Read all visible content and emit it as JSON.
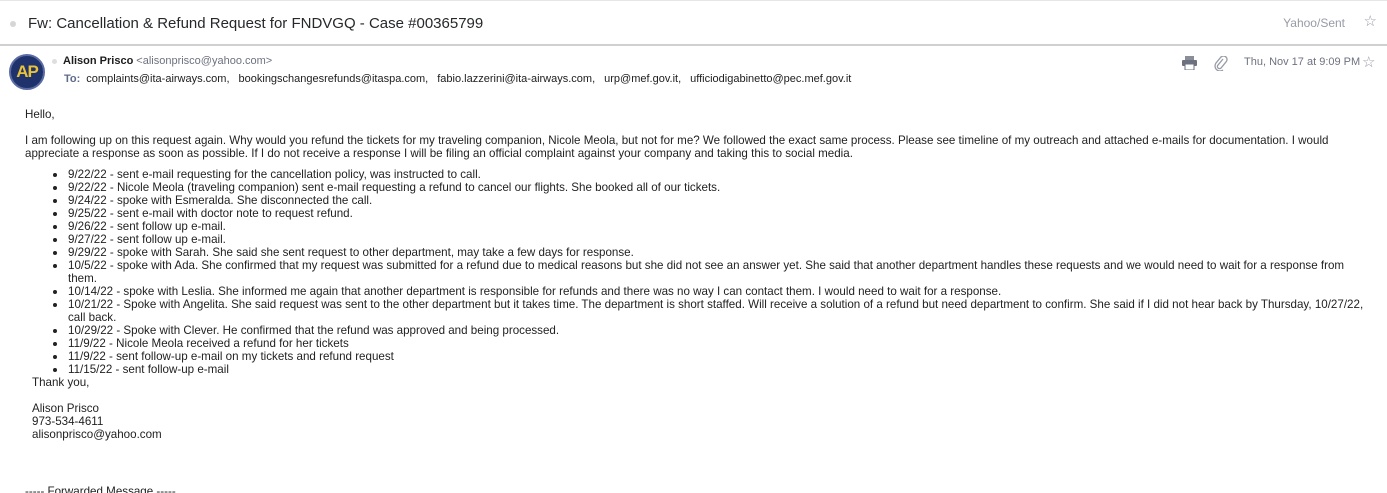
{
  "topbar": {
    "subject": "Fw: Cancellation & Refund Request for FNDVGQ - Case #00365799",
    "folder": "Yahoo/Sent"
  },
  "message": {
    "avatar_initials": "AP",
    "from_name": "Alison Prisco",
    "from_email": "<alisonprisco@yahoo.com>",
    "to_label": "To:",
    "to": [
      "complaints@ita-airways.com,",
      "bookingschangesrefunds@itaspa.com,",
      "fabio.lazzerini@ita-airways.com,",
      "urp@mef.gov.it,",
      "ufficiodigabinetto@pec.mef.gov.it"
    ],
    "date": "Thu, Nov 17 at 9:09 PM",
    "icons": {
      "print": "printer-icon",
      "attachment": "paperclip-icon",
      "star": "star-icon"
    }
  },
  "body": {
    "greeting": "Hello,",
    "paragraph": "I am following up on this request again. Why would you refund the tickets for my traveling companion, Nicole Meola, but not for me? We followed the exact same process. Please see timeline of my outreach and attached e-mails for documentation. I would appreciate a response as soon as possible. If I do not receive a response I will be filing an official complaint against your company and taking this to social media.",
    "timeline": [
      "9/22/22 - sent e-mail requesting for the cancellation policy, was instructed to call.",
      "9/22/22 - Nicole Meola (traveling companion) sent e-mail requesting a refund to cancel our flights. She booked all of our tickets.",
      "9/24/22 - spoke with Esmeralda. She disconnected the call.",
      "9/25/22 - sent e-mail with doctor note to request refund.",
      "9/26/22 - sent follow up e-mail.",
      "9/27/22 - sent follow up e-mail.",
      "9/29/22 - spoke with Sarah. She said she sent request to other department, may take a few days for response.",
      "10/5/22 - spoke with Ada. She confirmed that my request was submitted for a refund due to medical reasons but she did not see an answer yet. She said that another department handles these requests and we would need to wait for a response from them.",
      "10/14/22 - spoke with Leslia. She informed me again that another department is responsible for refunds and there was no way I can contact them. I would need to wait for a response.",
      "10/21/22 - Spoke with Angelita. She said request was sent to the other department but it takes time. The department is short staffed. Will receive a solution of a refund but need department to confirm. She said if I did not hear back by Thursday, 10/27/22, call back.",
      "10/29/22 - Spoke with Clever. He confirmed that the refund was approved and being processed.",
      "11/9/22 - Nicole Meola received a refund for her tickets",
      "11/9/22 - sent follow-up e-mail on my tickets and refund request",
      "11/15/22 - sent follow-up e-mail"
    ],
    "signoff": "Thank you,",
    "signature": {
      "name": "Alison Prisco",
      "phone": "973-534-4611",
      "email": "alisonprisco@yahoo.com"
    },
    "forwarded": "----- Forwarded Message -----"
  }
}
